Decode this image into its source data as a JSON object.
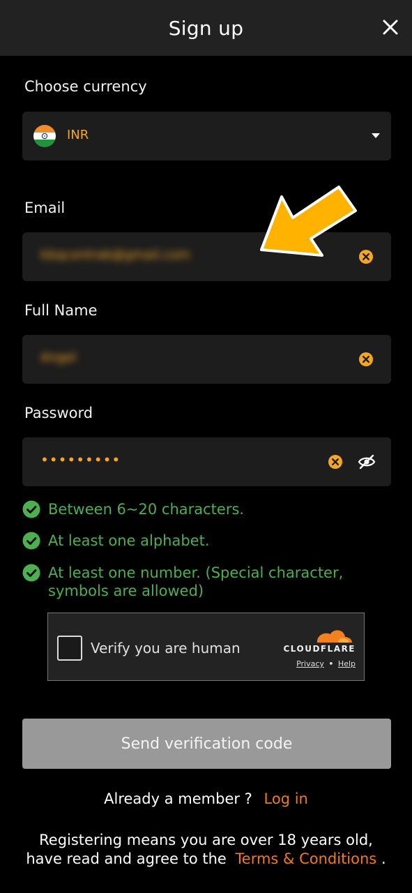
{
  "header": {
    "title": "Sign up"
  },
  "currency": {
    "label": "Choose currency",
    "value": "INR"
  },
  "email": {
    "label": "Email",
    "value": "kbqcontrab@gmail.com"
  },
  "full_name": {
    "label": "Full Name",
    "value": "Angel"
  },
  "password": {
    "label": "Password",
    "value": "•••••••••"
  },
  "rules": [
    {
      "text": "Between 6~20 characters."
    },
    {
      "text": "At least one alphabet."
    },
    {
      "text": "At least one number. (Special character, symbols are allowed)"
    }
  ],
  "captcha": {
    "label": "Verify you are human",
    "brand": "CLOUDFLARE",
    "privacy": "Privacy",
    "separator": "•",
    "help": "Help"
  },
  "actions": {
    "send_code": "Send verification code"
  },
  "login": {
    "prompt": "Already a member ?",
    "link": "Log in"
  },
  "legal": {
    "prefix": "Registering means you are over 18 years old, have read and agree to the",
    "link": "Terms & Conditions",
    "suffix": "."
  },
  "colors": {
    "accent": "#f5a623",
    "link": "#f07a1a",
    "success": "#4caf50",
    "annotation_arrow": "#ffb300"
  }
}
